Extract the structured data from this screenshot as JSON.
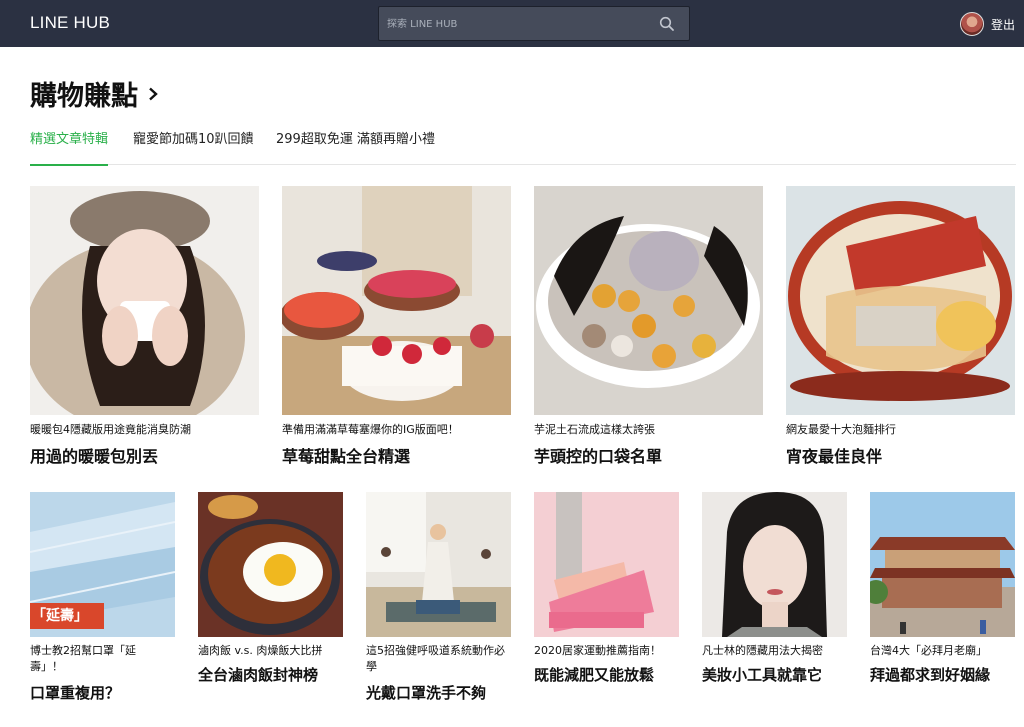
{
  "header": {
    "brand": "LINE HUB",
    "search_placeholder": "探索 LINE HUB",
    "logout_label": "登出"
  },
  "section": {
    "title": "購物賺點"
  },
  "tabs": [
    {
      "label": "精選文章特輯",
      "active": true
    },
    {
      "label": "寵愛節加碼10趴回饋",
      "active": false
    },
    {
      "label": "299超取免運 滿額再贈小禮",
      "active": false
    }
  ],
  "cards_row1": [
    {
      "subtitle": "暖暖包4隱藏版用途竟能消臭防潮",
      "title": "用過的暖暖包別丟",
      "image": "woman-holding-heat-pack"
    },
    {
      "subtitle": "準備用滿滿草莓塞爆你的IG版面吧！",
      "title": "草莓甜點全台精選",
      "image": "strawberry-desserts"
    },
    {
      "subtitle": "芋泥土石流成這樣太誇張",
      "title": "芋頭控的口袋名單",
      "image": "taro-dessert-bowl"
    },
    {
      "subtitle": "網友最愛十大泡麵排行",
      "title": "宵夜最佳良伴",
      "image": "instant-noodle-bowl"
    }
  ],
  "cards_row2": [
    {
      "subtitle": "博士教2招幫口罩「延壽」！",
      "title": "口罩重複用？",
      "image": "face-masks",
      "badge": "「延壽」"
    },
    {
      "subtitle": "滷肉飯 v.s. 肉燥飯大比拼",
      "title": "全台滷肉飯封神榜",
      "image": "braised-pork-rice"
    },
    {
      "subtitle": "這5招強健呼吸道系統動作必學",
      "title": "光戴口罩洗手不夠",
      "image": "yoga-class"
    },
    {
      "subtitle": "2020居家運動推薦指南！",
      "title": "既能減肥又能放鬆",
      "image": "stretch-board"
    },
    {
      "subtitle": "凡士林的隱藏用法大揭密",
      "title": "美妝小工具就靠它",
      "image": "woman-portrait"
    },
    {
      "subtitle": "台灣4大「必拜月老廟」",
      "title": "拜過都求到好姻緣",
      "image": "temple"
    }
  ],
  "colors": {
    "header_bg": "#2b3142",
    "active_tab": "#2ab04a",
    "badge_red": "#d9472b"
  }
}
